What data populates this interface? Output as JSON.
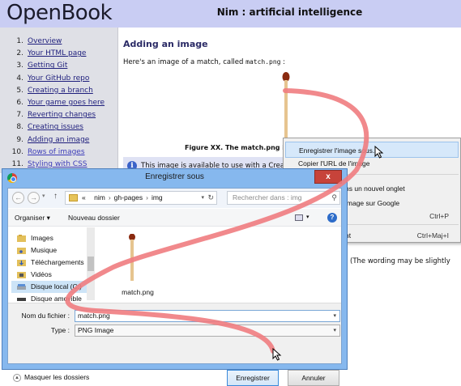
{
  "site": {
    "logo": "OpenBook",
    "page_title": "Nim : artificial intelligence"
  },
  "sidebar": {
    "items": [
      {
        "num": "1.",
        "label": "Overview"
      },
      {
        "num": "2.",
        "label": "Your HTML page"
      },
      {
        "num": "3.",
        "label": "Getting Git"
      },
      {
        "num": "4.",
        "label": "Your GitHub repo"
      },
      {
        "num": "5.",
        "label": "Creating a branch"
      },
      {
        "num": "6.",
        "label": "Your game goes here"
      },
      {
        "num": "7.",
        "label": "Reverting changes"
      },
      {
        "num": "8.",
        "label": "Creating issues"
      },
      {
        "num": "9.",
        "label": "Adding an image"
      },
      {
        "num": "10.",
        "label": "Rows of images"
      },
      {
        "num": "11.",
        "label": "Styling with CSS"
      }
    ]
  },
  "main": {
    "heading": "Adding an image",
    "intro_before": "Here's an image of a match, called ",
    "intro_code": "match.png",
    "intro_after": " :",
    "caption": "Figure XX. The match.png imag",
    "info_text": "This image is available to use with a Creativ",
    "wording_note": "(The wording may be slightly"
  },
  "context_menu": {
    "items": [
      {
        "label": "Enregistrer l'image sous...",
        "shortcut": ""
      },
      {
        "label": "Copier l'URL de l'image",
        "shortcut": ""
      },
      {
        "label": "ns un nouvel onglet",
        "shortcut": ""
      },
      {
        "label": "image sur Google",
        "shortcut": ""
      },
      {
        "label": "",
        "shortcut": "Ctrl+P"
      },
      {
        "label": "nt",
        "shortcut": "Ctrl+Maj+I"
      }
    ]
  },
  "dialog": {
    "title": "Enregistrer sous",
    "close": "x",
    "path": {
      "prefix": "«",
      "segments": [
        "nim",
        "gh-pages",
        "img"
      ]
    },
    "search_placeholder": "Rechercher dans : img",
    "organiser": "Organiser ▾",
    "new_folder": "Nouveau dossier",
    "help": "?",
    "nav_items": [
      {
        "label": "Images"
      },
      {
        "label": "Musique"
      },
      {
        "label": "Téléchargements"
      },
      {
        "label": "Vidéos"
      },
      {
        "label": "Disque local (C:)"
      },
      {
        "label": "Disque amovible"
      }
    ],
    "file": {
      "name": "match.png"
    },
    "filename_label": "Nom du fichier :",
    "filename_value": "match.png",
    "type_label": "Type :",
    "type_value": "PNG Image",
    "hide_folders": "Masquer les dossiers",
    "save_button": "Enregistrer",
    "cancel_button": "Annuler"
  },
  "colors": {
    "header_bg": "#c9cdf3",
    "sidebar_bg": "#dfe0e6",
    "dialog_frame": "#86b8ee",
    "annotation": "#f07c80"
  }
}
